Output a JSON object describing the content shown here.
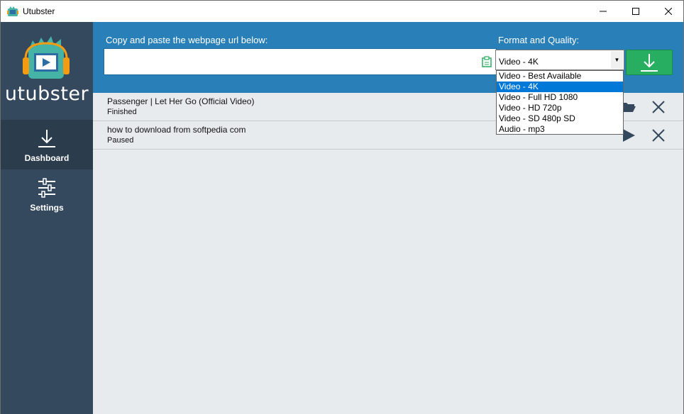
{
  "window": {
    "title": "Utubster"
  },
  "sidebar": {
    "brand": "utubster",
    "items": [
      {
        "label": "Dashboard",
        "icon": "download-arrow-icon",
        "active": true
      },
      {
        "label": "Settings",
        "icon": "sliders-icon",
        "active": false
      }
    ]
  },
  "url_panel": {
    "url_label": "Copy and paste the webpage url below:",
    "url_value": "",
    "format_label": "Format and Quality:",
    "format_selected": "Video - 4K",
    "format_options": [
      "Video - Best Available",
      "Video - 4K",
      "Video - Full HD 1080",
      "Video - HD 720p",
      "Video - SD 480p SD",
      "Audio - mp3"
    ],
    "download_icon": "download-arrow-icon"
  },
  "downloads": [
    {
      "title": "Passenger | Let Her Go (Official Video)",
      "status": "Finished",
      "action_icon": "folder-icon"
    },
    {
      "title": "how to download from softpedia com",
      "status": "Paused",
      "action_icon": "play-icon"
    }
  ],
  "colors": {
    "sidebar": "#34495e",
    "sidebar_active": "#2b3c4d",
    "url_panel": "#2980b9",
    "download_button": "#27ae60",
    "selection": "#0078d7"
  }
}
